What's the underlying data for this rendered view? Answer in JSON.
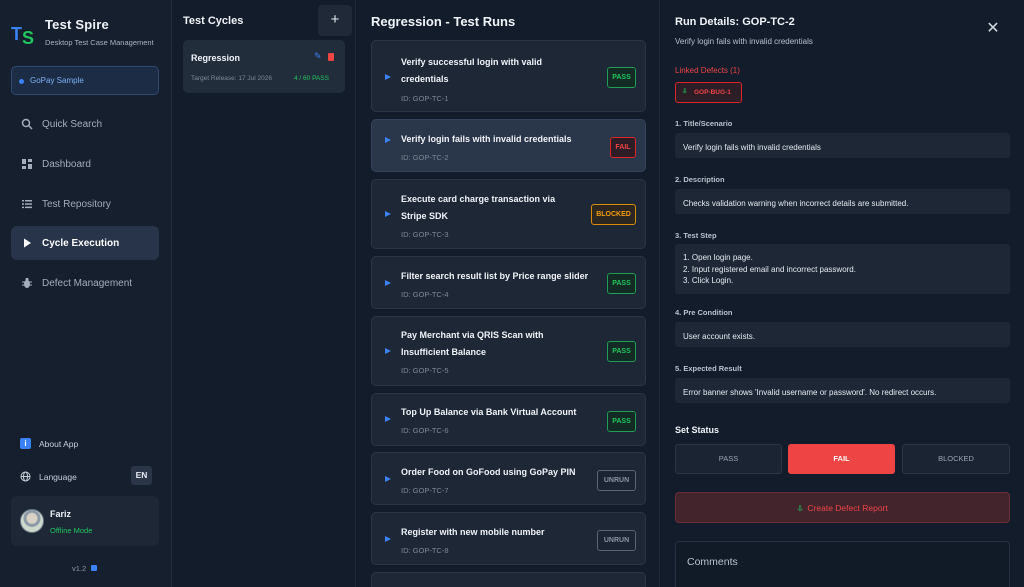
{
  "sidebar": {
    "app_title": "Test Spire",
    "app_subtitle": "Desktop Test Case Management",
    "project": "GoPay Sample",
    "nav": [
      {
        "label": "Quick Search",
        "icon": "search-icon"
      },
      {
        "label": "Dashboard",
        "icon": "dashboard-icon"
      },
      {
        "label": "Test Repository",
        "icon": "list-icon"
      },
      {
        "label": "Cycle Execution",
        "icon": "play-icon",
        "active": true
      },
      {
        "label": "Defect Management",
        "icon": "bug-icon"
      }
    ],
    "about": "About App",
    "language_label": "Language",
    "language_value": "EN",
    "user": {
      "name": "Fariz",
      "status": "Offline Mode"
    },
    "version": "v1.2"
  },
  "cycles": {
    "title": "Test Cycles",
    "add_label": "+",
    "items": [
      {
        "name": "Regression",
        "release": "Target Release: 17 Jul 2026",
        "progress": "4 / 60 PASS"
      }
    ]
  },
  "runs": {
    "title": "Regression - Test Runs",
    "items": [
      {
        "title": "Verify successful login with valid credentials",
        "id": "ID: GOP-TC-1",
        "status": "PASS"
      },
      {
        "title": "Verify login fails with invalid credentials",
        "id": "ID: GOP-TC-2",
        "status": "FAIL"
      },
      {
        "title": "Execute card charge transaction via Stripe SDK",
        "id": "ID: GOP-TC-3",
        "status": "BLOCKED"
      },
      {
        "title": "Filter search result list by Price range slider",
        "id": "ID: GOP-TC-4",
        "status": "PASS"
      },
      {
        "title": "Pay Merchant via QRIS Scan with Insufficient Balance",
        "id": "ID: GOP-TC-5",
        "status": "PASS"
      },
      {
        "title": "Top Up Balance via Bank Virtual Account",
        "id": "ID: GOP-TC-6",
        "status": "PASS"
      },
      {
        "title": "Order Food on GoFood using GoPay PIN",
        "id": "ID: GOP-TC-7",
        "status": "UNRUN"
      },
      {
        "title": "Register with new mobile number",
        "id": "ID: GOP-TC-8",
        "status": "UNRUN"
      }
    ]
  },
  "details": {
    "title": "Run Details: GOP-TC-2",
    "subtitle": "Verify login fails with invalid credentials",
    "linked_defects_label": "Linked Defects (1)",
    "bug_chip": "GOP-BUG-1",
    "fields": [
      {
        "label": "1. Title/Scenario",
        "value": "Verify login fails with invalid credentials"
      },
      {
        "label": "2. Description",
        "value": "Checks validation warning when incorrect details are submitted."
      },
      {
        "label": "3. Test Step",
        "value": "1. Open login page.\n2. Input registered email and incorrect password.\n3. Click Login."
      },
      {
        "label": "4. Pre Condition",
        "value": "User account exists."
      },
      {
        "label": "5. Expected Result",
        "value": "Error banner shows 'Invalid username or password'. No redirect occurs."
      }
    ],
    "set_status_label": "Set Status",
    "status_buttons": [
      "PASS",
      "FAIL",
      "BLOCKED"
    ],
    "active_status": "FAIL",
    "create_defect_label": "Create Defect Report",
    "comments_label": "Comments"
  },
  "colors": {
    "accent": "#3b82f6",
    "pass": "#22c55e",
    "fail": "#ef4444",
    "blocked": "#f59e0b",
    "unrun": "#8a94a3"
  }
}
